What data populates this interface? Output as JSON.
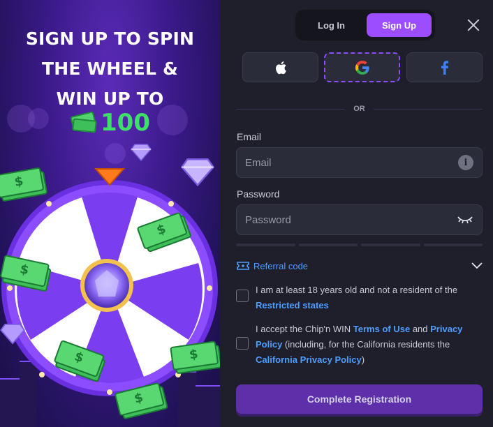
{
  "promo": {
    "headline_lines": [
      "SIGN UP TO SPIN",
      "THE WHEEL &",
      "WIN UP TO"
    ],
    "amount": "100",
    "colors": {
      "amount": "#3fe06a",
      "wheel_ring": "#7b3df0",
      "background": "#3b1a8a"
    }
  },
  "auth": {
    "tabs": [
      {
        "label": "Log In",
        "active": false
      },
      {
        "label": "Sign Up",
        "active": true
      }
    ],
    "social": [
      {
        "name": "apple-icon"
      },
      {
        "name": "google-icon"
      },
      {
        "name": "facebook-icon"
      }
    ],
    "or_text": "OR"
  },
  "email": {
    "label": "Email",
    "placeholder": "Email",
    "value": ""
  },
  "password": {
    "label": "Password",
    "placeholder": "Password",
    "value": ""
  },
  "referral": {
    "label": "Referral code"
  },
  "age_check": {
    "text": "I am at least 18 years old and not a resident of the",
    "link": "Restricted states"
  },
  "terms_check": {
    "text_1": "I accept the Chip'n WIN",
    "link_1": "Terms of Use",
    "text_2": "and",
    "link_2": "Privacy Policy",
    "text_3": "(including, for the California residents the",
    "link_3": "California Privacy Policy",
    "text_4": ")"
  },
  "submit": {
    "label": "Complete Registration"
  },
  "colors": {
    "accent": "#9b4dff",
    "link": "#4f9dff",
    "panel": "#1e1f2b",
    "submit": "#5d2fa8"
  }
}
